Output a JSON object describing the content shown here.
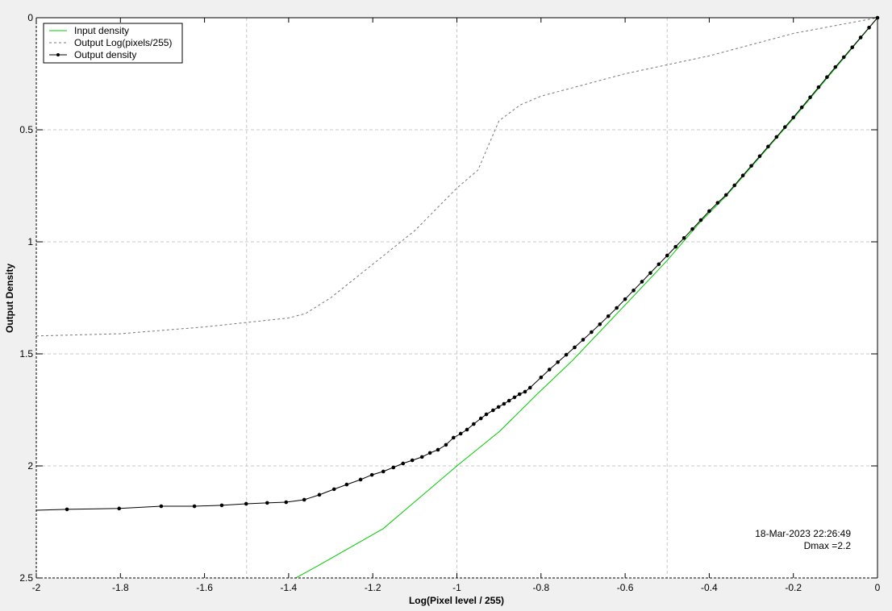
{
  "chart_data": {
    "type": "line",
    "title": "",
    "xlabel": "Log(Pixel level / 255)",
    "ylabel": "Output Density",
    "xlim": [
      -2,
      0
    ],
    "ylim": [
      0,
      2.5
    ],
    "y_inverted": true,
    "grid": true,
    "x_ticks": [
      -2,
      -1.8,
      -1.6,
      -1.4,
      -1.2,
      -1,
      -0.8,
      -0.6,
      -0.4,
      -0.2,
      0
    ],
    "x_tick_labels": [
      "-2",
      "-1.8",
      "-1.6",
      "-1.4",
      "-1.2",
      "-1",
      "-0.8",
      "-0.6",
      "-0.4",
      "-0.2",
      "0"
    ],
    "x_grid": [
      -1.5,
      -1,
      -0.5
    ],
    "y_ticks": [
      0,
      0.5,
      1,
      1.5,
      2,
      2.5
    ],
    "y_tick_labels": [
      "0",
      "0.5",
      "1",
      "1.5",
      "2",
      "2.5"
    ],
    "y_grid": [
      0.5,
      1,
      1.5,
      2
    ],
    "legend_position": "top-left",
    "annotations": [
      "18-Mar-2023 22:26:49",
      "Dmax =2.2"
    ],
    "series": [
      {
        "name": "Input density",
        "style": "solid",
        "color": "#00cc00",
        "markers": false,
        "points": [
          [
            -1.383,
            2.5
          ],
          [
            -1.325,
            2.44
          ],
          [
            -1.175,
            2.28
          ],
          [
            -1.1,
            2.16
          ],
          [
            -1.0,
            2.0
          ],
          [
            -0.898,
            1.845
          ],
          [
            -0.807,
            1.676
          ],
          [
            -0.725,
            1.529
          ],
          [
            -0.585,
            1.252
          ],
          [
            -0.5,
            1.083
          ],
          [
            -0.424,
            0.917
          ],
          [
            -0.36,
            0.795
          ],
          [
            -0.2,
            0.45
          ],
          [
            0,
            0
          ]
        ]
      },
      {
        "name": "Output Log(pixels/255)",
        "style": "dashed",
        "color": "#777777",
        "markers": false,
        "points": [
          [
            -2,
            1.42
          ],
          [
            -1.8,
            1.41
          ],
          [
            -1.6,
            1.38
          ],
          [
            -1.4,
            1.34
          ],
          [
            -1.36,
            1.32
          ],
          [
            -1.3,
            1.25
          ],
          [
            -1.2,
            1.1
          ],
          [
            -1.1,
            0.95
          ],
          [
            -1.0,
            0.76
          ],
          [
            -0.95,
            0.68
          ],
          [
            -0.9,
            0.46
          ],
          [
            -0.85,
            0.39
          ],
          [
            -0.8,
            0.35
          ],
          [
            -0.7,
            0.3
          ],
          [
            -0.6,
            0.25
          ],
          [
            -0.5,
            0.21
          ],
          [
            -0.4,
            0.17
          ],
          [
            -0.3,
            0.12
          ],
          [
            -0.2,
            0.07
          ],
          [
            -0.1,
            0.035
          ],
          [
            0,
            0
          ]
        ]
      },
      {
        "name": "Output density",
        "style": "solid",
        "color": "#000000",
        "markers": true,
        "line_start": [
          -2,
          2.198
        ],
        "points": [
          [
            -1.927,
            2.194
          ],
          [
            -1.803,
            2.19
          ],
          [
            -1.703,
            2.18
          ],
          [
            -1.624,
            2.18
          ],
          [
            -1.559,
            2.176
          ],
          [
            -1.501,
            2.169
          ],
          [
            -1.451,
            2.165
          ],
          [
            -1.406,
            2.162
          ],
          [
            -1.363,
            2.151
          ],
          [
            -1.327,
            2.129
          ],
          [
            -1.292,
            2.104
          ],
          [
            -1.262,
            2.083
          ],
          [
            -1.229,
            2.061
          ],
          [
            -1.202,
            2.04
          ],
          [
            -1.175,
            2.025
          ],
          [
            -1.151,
            2.007
          ],
          [
            -1.128,
            1.989
          ],
          [
            -1.106,
            1.975
          ],
          [
            -1.083,
            1.96
          ],
          [
            -1.064,
            1.942
          ],
          [
            -1.045,
            1.928
          ],
          [
            -1.026,
            1.906
          ],
          [
            -1.008,
            1.874
          ],
          [
            -0.991,
            1.856
          ],
          [
            -0.976,
            1.838
          ],
          [
            -0.96,
            1.813
          ],
          [
            -0.943,
            1.788
          ],
          [
            -0.93,
            1.77
          ],
          [
            -0.914,
            1.752
          ],
          [
            -0.901,
            1.737
          ],
          [
            -0.888,
            1.723
          ],
          [
            -0.876,
            1.709
          ],
          [
            -0.863,
            1.694
          ],
          [
            -0.851,
            1.68
          ],
          [
            -0.838,
            1.669
          ],
          [
            -0.826,
            1.651
          ],
          [
            -0.8,
            1.605
          ],
          [
            -0.78,
            1.57
          ],
          [
            -0.76,
            1.537
          ],
          [
            -0.74,
            1.504
          ],
          [
            -0.72,
            1.471
          ],
          [
            -0.7,
            1.437
          ],
          [
            -0.68,
            1.403
          ],
          [
            -0.66,
            1.368
          ],
          [
            -0.64,
            1.332
          ],
          [
            -0.62,
            1.295
          ],
          [
            -0.6,
            1.256
          ],
          [
            -0.58,
            1.217
          ],
          [
            -0.56,
            1.178
          ],
          [
            -0.54,
            1.139
          ],
          [
            -0.52,
            1.1
          ],
          [
            -0.5,
            1.061
          ],
          [
            -0.48,
            1.022
          ],
          [
            -0.46,
            0.983
          ],
          [
            -0.44,
            0.943
          ],
          [
            -0.42,
            0.903
          ],
          [
            -0.4,
            0.863
          ],
          [
            -0.38,
            0.826
          ],
          [
            -0.36,
            0.791
          ],
          [
            -0.34,
            0.748
          ],
          [
            -0.32,
            0.704
          ],
          [
            -0.3,
            0.661
          ],
          [
            -0.28,
            0.618
          ],
          [
            -0.26,
            0.575
          ],
          [
            -0.24,
            0.532
          ],
          [
            -0.22,
            0.488
          ],
          [
            -0.2,
            0.445
          ],
          [
            -0.18,
            0.4
          ],
          [
            -0.16,
            0.355
          ],
          [
            -0.14,
            0.31
          ],
          [
            -0.12,
            0.265
          ],
          [
            -0.1,
            0.22
          ],
          [
            -0.08,
            0.176
          ],
          [
            -0.06,
            0.132
          ],
          [
            -0.04,
            0.088
          ],
          [
            -0.02,
            0.044
          ],
          [
            0,
            0
          ]
        ]
      }
    ]
  }
}
